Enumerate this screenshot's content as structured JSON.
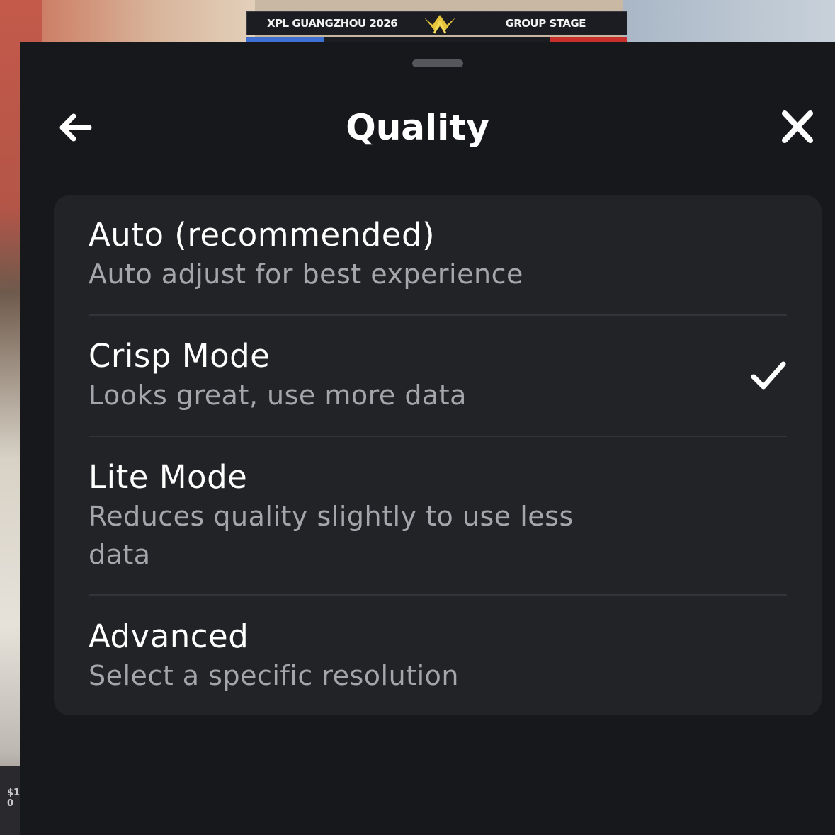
{
  "background": {
    "hud_left": "XPL GUANGZHOU 2026",
    "hud_right": "GROUP STAGE",
    "money_fragment": "$1 \n0",
    "stripe_colors": [
      "#3e6fd2",
      "#1c1d22",
      "#c9302c"
    ]
  },
  "sheet": {
    "title": "Quality",
    "back_icon": "arrow-left-icon",
    "close_icon": "close-icon",
    "options": [
      {
        "title": "Auto (recommended)",
        "desc": "Auto adjust for best experience",
        "selected": false
      },
      {
        "title": "Crisp Mode",
        "desc": "Looks great, use more data",
        "selected": true
      },
      {
        "title": "Lite Mode",
        "desc": "Reduces quality slightly to use less data",
        "selected": false
      },
      {
        "title": "Advanced",
        "desc": "Select a specific resolution",
        "selected": false
      }
    ],
    "check_icon": "checkmark-icon"
  },
  "colors": {
    "sheet_bg": "#17181b",
    "card_bg": "#222326",
    "title_text": "#ffffff",
    "desc_text": "#a5a6ab"
  }
}
